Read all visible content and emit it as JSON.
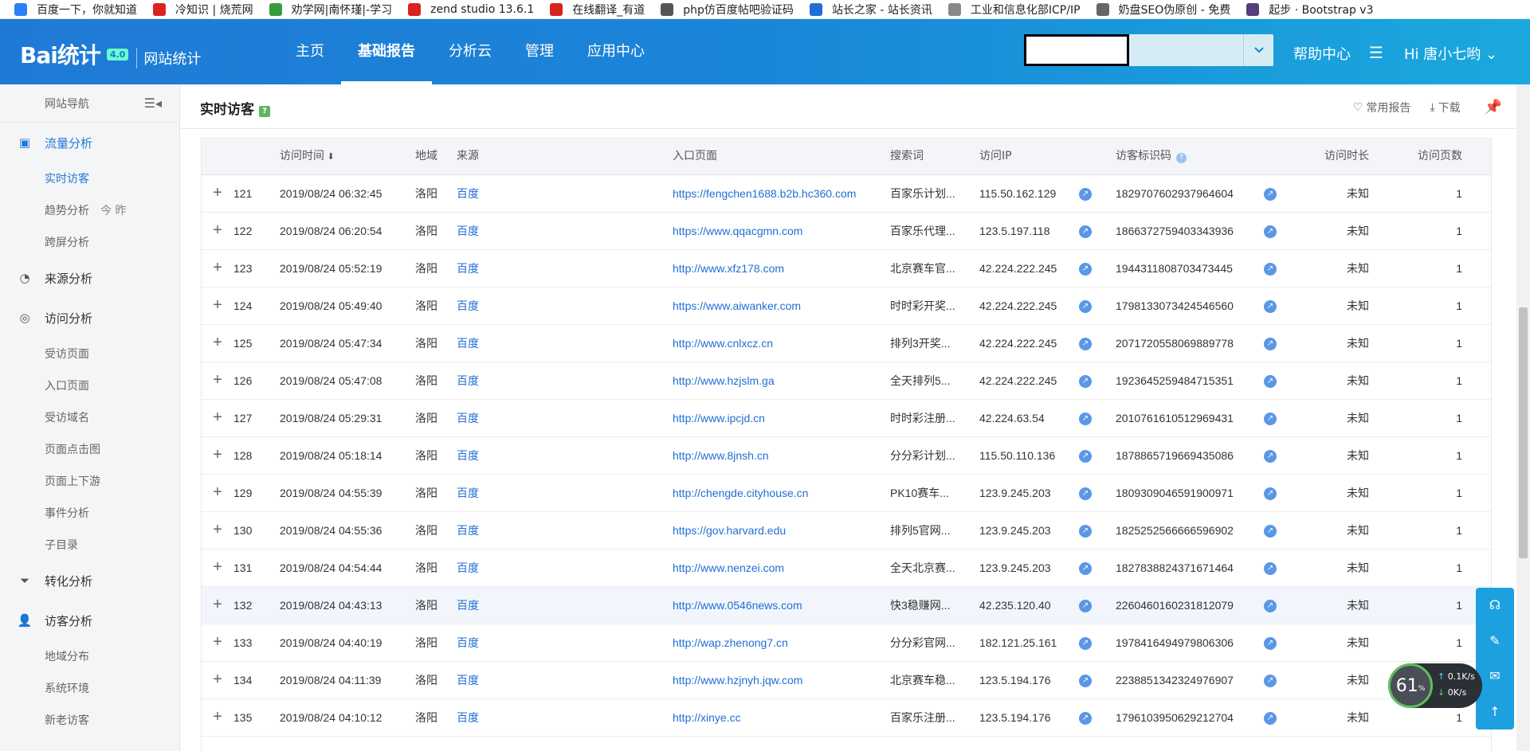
{
  "bookmarks": [
    {
      "label": "百度一下，你就知道",
      "icon": "baidu-paw-icon",
      "color": "#2d7ff9"
    },
    {
      "label": "冷知识 | 烧荒网",
      "icon": "fire-icon",
      "color": "#d9231f"
    },
    {
      "label": "劝学网|南怀瑾|-学习",
      "icon": "quanxue-icon",
      "color": "#3a9b3a"
    },
    {
      "label": "zend studio 13.6.1",
      "icon": "zend-icon",
      "color": "#d9231f"
    },
    {
      "label": "在线翻译_有道",
      "icon": "youdao-icon",
      "color": "#d9231f"
    },
    {
      "label": "php仿百度帖吧验证码",
      "icon": "gear-icon",
      "color": "#555555"
    },
    {
      "label": "站长之家 - 站长资讯",
      "icon": "chinaz-icon",
      "color": "#1f6fd4"
    },
    {
      "label": "工业和信息化部ICP/IP",
      "icon": "document-icon",
      "color": "#888888"
    },
    {
      "label": "奶盘SEO伪原创 - 免费",
      "icon": "globe-icon",
      "color": "#666666"
    },
    {
      "label": "起步 · Bootstrap v3",
      "icon": "bootstrap-icon",
      "color": "#563d7c"
    }
  ],
  "header": {
    "logo": "Bai统计",
    "version": "4.0",
    "subtitle": "网站统计",
    "nav": [
      "主页",
      "基础报告",
      "分析云",
      "管理",
      "应用中心"
    ],
    "active_nav": 1,
    "help": "帮助中心",
    "user": "Hi  唐小七哟"
  },
  "sidebar": {
    "title": "网站导航",
    "sections": [
      {
        "label": "流量分析",
        "icon": "chart-icon",
        "active": true,
        "items": [
          {
            "label": "实时访客",
            "active": true
          },
          {
            "label": "趋势分析",
            "extra": "今   昨"
          },
          {
            "label": "跨屏分析"
          }
        ]
      },
      {
        "label": "来源分析",
        "icon": "pie-icon",
        "items": []
      },
      {
        "label": "访问分析",
        "icon": "spiral-icon",
        "items": [
          {
            "label": "受访页面"
          },
          {
            "label": "入口页面"
          },
          {
            "label": "受访域名"
          },
          {
            "label": "页面点击图"
          },
          {
            "label": "页面上下游"
          },
          {
            "label": "事件分析"
          },
          {
            "label": "子目录"
          }
        ]
      },
      {
        "label": "转化分析",
        "icon": "funnel-icon",
        "items": []
      },
      {
        "label": "访客分析",
        "icon": "user-icon",
        "items": [
          {
            "label": "地域分布"
          },
          {
            "label": "系统环境"
          },
          {
            "label": "新老访客"
          }
        ]
      }
    ]
  },
  "page": {
    "title": "实时访客",
    "actions": {
      "favorite": "常用报告",
      "download": "下载"
    }
  },
  "table": {
    "columns": [
      "",
      "",
      "访问时间",
      "地域",
      "来源",
      "入口页面",
      "搜索词",
      "访问IP",
      "",
      "访客标识码",
      "",
      "访问时长",
      "访问页数"
    ],
    "rows": [
      [
        "121",
        "2019/08/24 06:32:45",
        "洛阳",
        "百度",
        "https://fengchen1688.b2b.hc360.com",
        "百家乐计划...",
        "115.50.162.129",
        "1829707602937964604",
        "未知",
        "1"
      ],
      [
        "122",
        "2019/08/24 06:20:54",
        "洛阳",
        "百度",
        "https://www.qqacgmn.com",
        "百家乐代理...",
        "123.5.197.118",
        "1866372759403343936",
        "未知",
        "1"
      ],
      [
        "123",
        "2019/08/24 05:52:19",
        "洛阳",
        "百度",
        "http://www.xfz178.com",
        "北京赛车官...",
        "42.224.222.245",
        "1944311808703473445",
        "未知",
        "1"
      ],
      [
        "124",
        "2019/08/24 05:49:40",
        "洛阳",
        "百度",
        "https://www.aiwanker.com",
        "时时彩开奖...",
        "42.224.222.245",
        "1798133073424546560",
        "未知",
        "1"
      ],
      [
        "125",
        "2019/08/24 05:47:34",
        "洛阳",
        "百度",
        "http://www.cnlxcz.cn",
        "排列3开奖...",
        "42.224.222.245",
        "2071720558069889778",
        "未知",
        "1"
      ],
      [
        "126",
        "2019/08/24 05:47:08",
        "洛阳",
        "百度",
        "http://www.hzjslm.ga",
        "全天排列5...",
        "42.224.222.245",
        "1923645259484715351",
        "未知",
        "1"
      ],
      [
        "127",
        "2019/08/24 05:29:31",
        "洛阳",
        "百度",
        "http://www.ipcjd.cn",
        "时时彩注册...",
        "42.224.63.54",
        "2010761610512969431",
        "未知",
        "1"
      ],
      [
        "128",
        "2019/08/24 05:18:14",
        "洛阳",
        "百度",
        "http://www.8jnsh.cn",
        "分分彩计划...",
        "115.50.110.136",
        "1878865719669435086",
        "未知",
        "1"
      ],
      [
        "129",
        "2019/08/24 04:55:39",
        "洛阳",
        "百度",
        "http://chengde.cityhouse.cn",
        "PK10赛车...",
        "123.9.245.203",
        "1809309046591900971",
        "未知",
        "1"
      ],
      [
        "130",
        "2019/08/24 04:55:36",
        "洛阳",
        "百度",
        "https://gov.harvard.edu",
        "排列5官网...",
        "123.9.245.203",
        "1825252566666596902",
        "未知",
        "1"
      ],
      [
        "131",
        "2019/08/24 04:54:44",
        "洛阳",
        "百度",
        "http://www.nenzei.com",
        "全天北京赛...",
        "123.9.245.203",
        "1827838824371671464",
        "未知",
        "1"
      ],
      [
        "132",
        "2019/08/24 04:43:13",
        "洛阳",
        "百度",
        "http://www.0546news.com",
        "快3稳赚网...",
        "42.235.120.40",
        "2260460160231812079",
        "未知",
        "1"
      ],
      [
        "133",
        "2019/08/24 04:40:19",
        "洛阳",
        "百度",
        "http://wap.zhenong7.cn",
        "分分彩官网...",
        "182.121.25.161",
        "1978416494979806306",
        "未知",
        "1"
      ],
      [
        "134",
        "2019/08/24 04:11:39",
        "洛阳",
        "百度",
        "http://www.hzjnyh.jqw.com",
        "北京赛车稳...",
        "123.5.194.176",
        "2238851342324976907",
        "未知",
        "1"
      ],
      [
        "135",
        "2019/08/24 04:10:12",
        "洛阳",
        "百度",
        "http://xinye.cc",
        "百家乐注册...",
        "123.5.194.176",
        "1796103950629212704",
        "未知",
        "1"
      ]
    ],
    "highlight_row": 11
  },
  "network_widget": {
    "percent": "61",
    "unit": "%",
    "up": "0.1K/s",
    "down": "0K/s"
  },
  "colors": {
    "accent": "#1f7ad6",
    "link": "#1f6fd4"
  }
}
